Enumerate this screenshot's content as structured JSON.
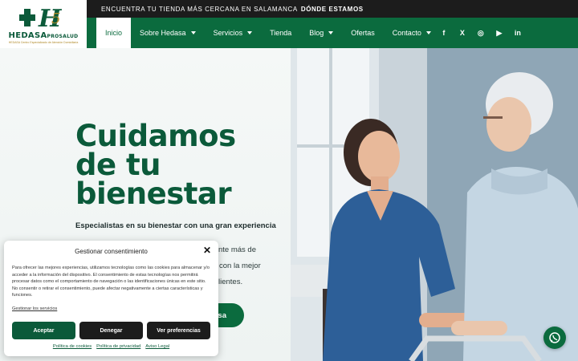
{
  "brand": {
    "logo_text": "HEDASA",
    "logo_suffix": "PROSALUD",
    "logo_tagline": "HEDASA Centro Especializado de Atención Domiciliaria",
    "colors": {
      "primary": "#0b6b3e",
      "dark": "#1c1c1c",
      "gold": "#b08a2a"
    }
  },
  "topbar": {
    "text": "ENCUENTRA TU TIENDA MÁS CERCANA EN SALAMANCA",
    "link": "DÓNDE ESTAMOS"
  },
  "nav": {
    "items": [
      {
        "label": "Inicio",
        "active": true,
        "dropdown": false
      },
      {
        "label": "Sobre Hedasa",
        "active": false,
        "dropdown": true
      },
      {
        "label": "Servicios",
        "active": false,
        "dropdown": true
      },
      {
        "label": "Tienda",
        "active": false,
        "dropdown": false
      },
      {
        "label": "Blog",
        "active": false,
        "dropdown": true
      },
      {
        "label": "Ofertas",
        "active": false,
        "dropdown": false
      },
      {
        "label": "Contacto",
        "active": false,
        "dropdown": true
      }
    ],
    "socials": [
      {
        "icon": "facebook-icon",
        "glyph": "f"
      },
      {
        "icon": "x-icon",
        "glyph": "X"
      },
      {
        "icon": "instagram-icon",
        "glyph": "◎"
      },
      {
        "icon": "youtube-icon",
        "glyph": "▶"
      },
      {
        "icon": "linkedin-icon",
        "glyph": "in"
      }
    ]
  },
  "hero": {
    "headline": [
      "Cuidamos",
      "de tu",
      "bienestar"
    ],
    "subhead": "Especialistas en su bienestar con una gran experiencia",
    "body_fragments": [
      "nte más de",
      "con la mejor",
      "lientes."
    ],
    "cta_label": "sa"
  },
  "consent": {
    "title": "Gestionar consentimiento",
    "text": "Para ofrecer las mejores experiencias, utilizamos tecnologías como las cookies para almacenar y/o acceder a la información del dispositivo. El consentimiento de estas tecnologías nos permitirá procesar datos como el comportamiento de navegación o las identificaciones únicas en este sitio. No consentir o retirar el consentimiento, puede afectar negativamente a ciertas características y funciones.",
    "manage_link": "Gestionar los servicios",
    "accept": "Aceptar",
    "deny": "Denegar",
    "preferences": "Ver preferencias",
    "footer_links": [
      "Política de cookies",
      "Política de privacidad",
      "Aviso Legal"
    ]
  }
}
